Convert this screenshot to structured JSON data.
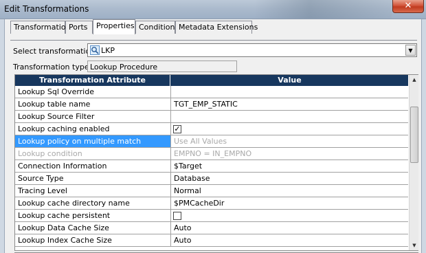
{
  "window": {
    "title": "Edit Transformations",
    "close_label": "✕"
  },
  "tabs": [
    {
      "label": "Transformation"
    },
    {
      "label": "Ports"
    },
    {
      "label": "Properties"
    },
    {
      "label": "Condition"
    },
    {
      "label": "Metadata Extensions"
    }
  ],
  "active_tab": "Properties",
  "select_transformation": {
    "label": "Select transformation:",
    "value": "LKP"
  },
  "transformation_type": {
    "label": "Transformation type:",
    "value": "Lookup Procedure"
  },
  "grid": {
    "headers": [
      "Transformation Attribute",
      "Value"
    ],
    "rows": [
      {
        "attribute": "Lookup Sql Override",
        "value": ""
      },
      {
        "attribute": "Lookup table name",
        "value": "TGT_EMP_STATIC"
      },
      {
        "attribute": "Lookup Source Filter",
        "value": ""
      },
      {
        "attribute": "Lookup caching enabled",
        "value": "",
        "checkbox": true,
        "checked": true
      },
      {
        "attribute": "Lookup policy on multiple match",
        "value": "Use All Values",
        "selected": true,
        "disabled_value": true
      },
      {
        "attribute": "Lookup condition",
        "value": "EMPNO = IN_EMPNO",
        "disabled": true
      },
      {
        "attribute": "Connection Information",
        "value": "$Target"
      },
      {
        "attribute": "Source Type",
        "value": "Database"
      },
      {
        "attribute": "Tracing Level",
        "value": "Normal"
      },
      {
        "attribute": "Lookup cache directory name",
        "value": "$PMCacheDir"
      },
      {
        "attribute": "Lookup cache persistent",
        "value": "",
        "checkbox": true,
        "checked": false
      },
      {
        "attribute": "Lookup Data Cache Size",
        "value": "Auto"
      },
      {
        "attribute": "Lookup Index Cache Size",
        "value": "Auto"
      }
    ]
  },
  "colors": {
    "header_bg": "#17375e",
    "selection": "#3399ff",
    "disabled_text": "#a8a8a8"
  }
}
